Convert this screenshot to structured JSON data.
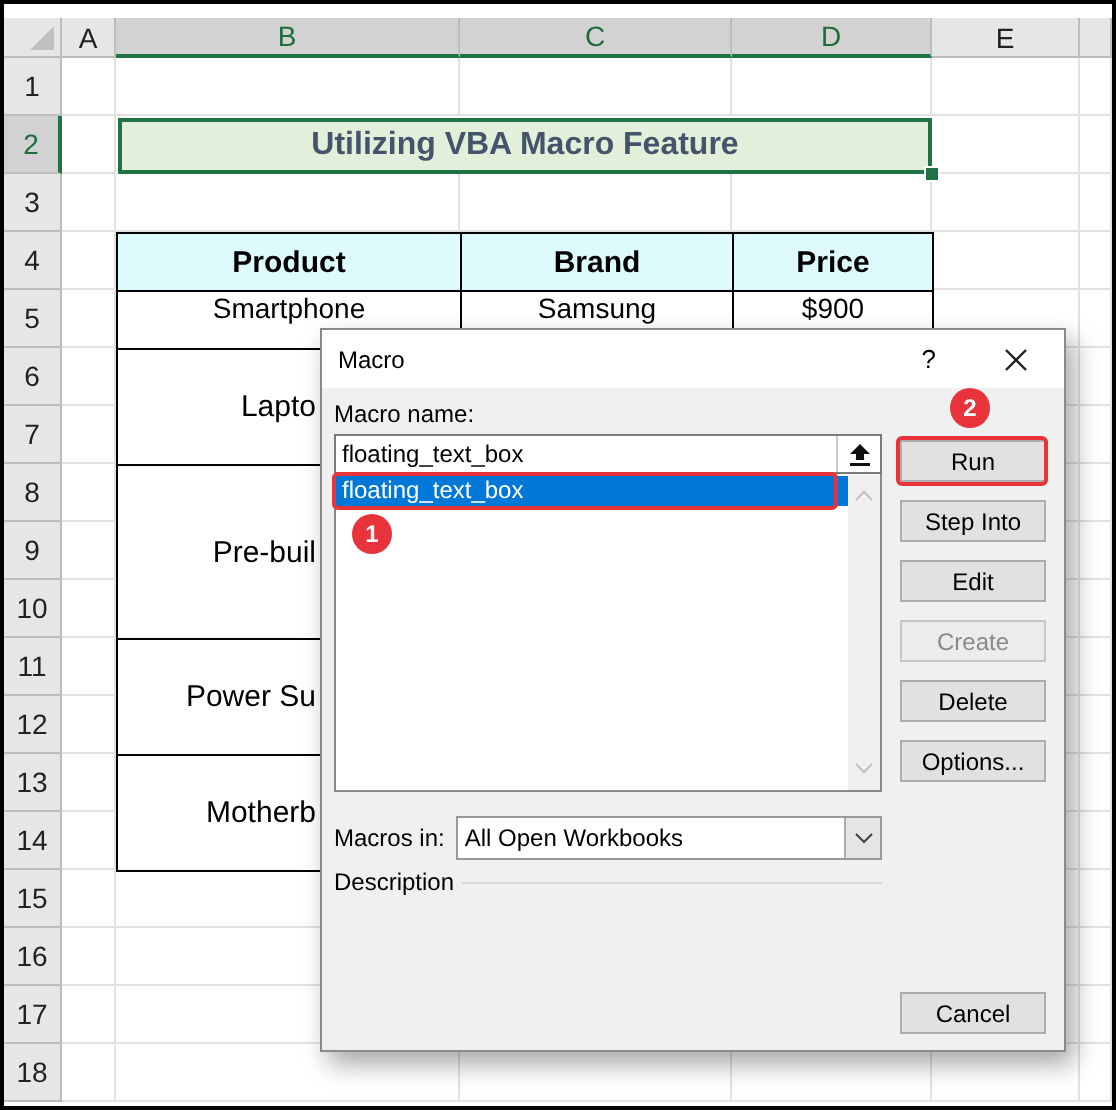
{
  "columns": [
    {
      "label": "A",
      "selected": false
    },
    {
      "label": "B",
      "selected": true
    },
    {
      "label": "C",
      "selected": true
    },
    {
      "label": "D",
      "selected": true
    },
    {
      "label": "E",
      "selected": false
    }
  ],
  "rows": [
    {
      "label": "1",
      "selected": false
    },
    {
      "label": "2",
      "selected": true
    },
    {
      "label": "3",
      "selected": false
    },
    {
      "label": "4",
      "selected": false
    },
    {
      "label": "5",
      "selected": false
    },
    {
      "label": "6",
      "selected": false
    },
    {
      "label": "7",
      "selected": false
    },
    {
      "label": "8",
      "selected": false
    },
    {
      "label": "9",
      "selected": false
    },
    {
      "label": "10",
      "selected": false
    },
    {
      "label": "11",
      "selected": false
    },
    {
      "label": "12",
      "selected": false
    },
    {
      "label": "13",
      "selected": false
    },
    {
      "label": "14",
      "selected": false
    },
    {
      "label": "15",
      "selected": false
    },
    {
      "label": "16",
      "selected": false
    },
    {
      "label": "17",
      "selected": false
    },
    {
      "label": "18",
      "selected": false
    }
  ],
  "title_cell": {
    "text": "Utilizing VBA Macro Feature"
  },
  "table": {
    "columns": [
      "Product",
      "Brand",
      "Price"
    ],
    "rows": [
      {
        "product": "Smartphone",
        "brand": "Samsung",
        "price": "$900"
      },
      {
        "product": "Lapto"
      },
      {
        "product": "Pre-buil"
      },
      {
        "product": "Power Su"
      },
      {
        "product": "Motherb"
      }
    ]
  },
  "dialog": {
    "title": "Macro",
    "help": "?",
    "macro_name": {
      "label": "Macro name:",
      "value": "floating_text_box"
    },
    "macro_list": [
      {
        "name": "floating_text_box",
        "selected": true
      }
    ],
    "buttons": [
      {
        "label": "Run",
        "disabled": false
      },
      {
        "label": "Step Into",
        "disabled": false
      },
      {
        "label": "Edit",
        "disabled": false
      },
      {
        "label": "Create",
        "disabled": true
      },
      {
        "label": "Delete",
        "disabled": false
      },
      {
        "label": "Options...",
        "disabled": false
      }
    ],
    "cancel": "Cancel",
    "macros_in": {
      "label": "Macros in:",
      "value": "All Open Workbooks"
    },
    "description_label": "Description"
  },
  "annotations": [
    {
      "label": "1"
    },
    {
      "label": "2"
    }
  ]
}
